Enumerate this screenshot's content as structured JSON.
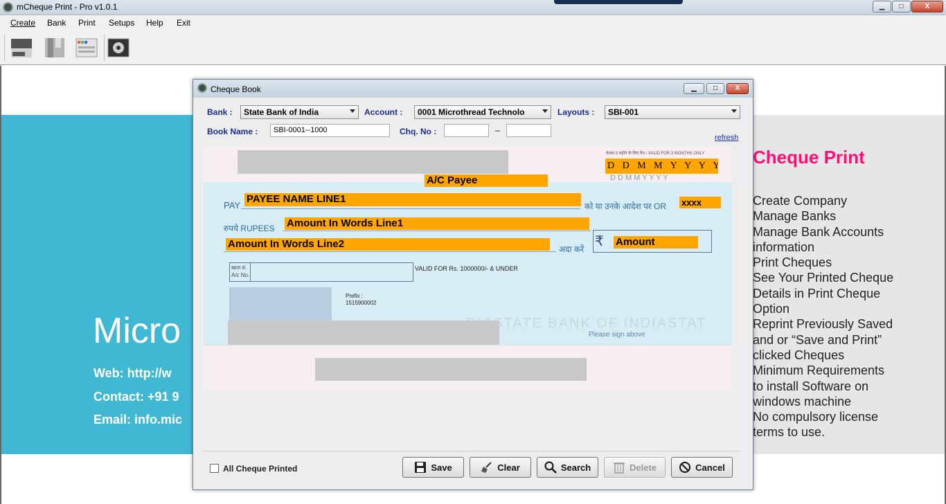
{
  "window": {
    "title": "mCheque Print - Pro v1.0.1",
    "min": "▁",
    "max": "□",
    "close": "X"
  },
  "menu": [
    "Create",
    "Bank",
    "Print",
    "Setups",
    "Help",
    "Exit"
  ],
  "background": {
    "micro_text": "Micro",
    "web": "Web:  http://w",
    "contact": "Contact: +91  9",
    "email": "Email: info.mic",
    "brand_title": "Cheque Print",
    "features": [
      "Create Company",
      "Manage Banks",
      "Manage Bank Accounts",
      "information",
      "Print Cheques",
      "See Your Printed Cheque",
      "Details in Print Cheque",
      "Option",
      "Reprint Previously Saved",
      "and or “Save and Print”",
      "clicked Cheques",
      "Minimum Requirements",
      "to install Software on",
      "windows machine",
      "No compulsory license",
      "terms to use."
    ]
  },
  "dialog": {
    "title": "Cheque Book",
    "bank_label": "Bank :",
    "bank_value": "State Bank of India",
    "account_label": "Account :",
    "account_value": "0001 Microthread Technolo",
    "layouts_label": "Layouts :",
    "layouts_value": "SBI-001",
    "book_name_label": "Book Name :",
    "book_name_value": "SBI-0001--1000",
    "chq_no_label": "Chq. No :",
    "chq_from": "",
    "chq_dash": "–",
    "chq_to": "",
    "refresh": "refresh"
  },
  "cheque": {
    "validity_note": "केवल 3 महीने के लिए वैध / VALID FOR 3 MONTHS ONLY",
    "date_fields": "D D M M Y Y Y Y",
    "date_print": "D   D   M   M   Y   Y   Y   Y",
    "ac_payee": "A/C Payee",
    "pay": "PAY",
    "payee": "PAYEE NAME LINE1",
    "or_bearer_hindi": "को या उनके आदेश पर OR",
    "bearer_x": "xxxx",
    "rupees": "रुपये RUPEES",
    "words1": "Amount In Words Line1",
    "words2": "Amount In Words Line2",
    "ada_karen": "अदा करें",
    "rupee_symbol": "₹",
    "amount": "Amount",
    "acno_label_hi": "खाता सं.",
    "acno_label": "A/c No.",
    "valid_for": "VALID FOR Rs. 1000000/- & UNDER",
    "prefix_label": "Prefix :",
    "prefix_value": "1515900002",
    "sign_above": "Please sign above",
    "watermark": "DIASTATE BANK OF INDIASTAT"
  },
  "bottom": {
    "all_printed": "All Cheque Printed",
    "save": "Save",
    "clear": "Clear",
    "search": "Search",
    "delete": "Delete",
    "cancel": "Cancel"
  }
}
